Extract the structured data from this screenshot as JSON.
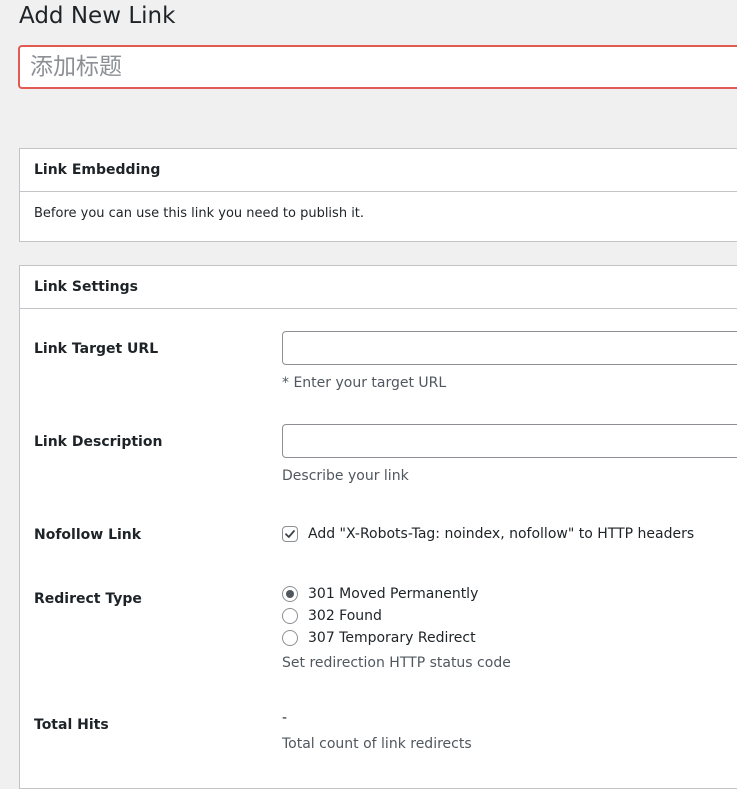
{
  "page": {
    "title": "Add New Link",
    "title_placeholder": "添加标题"
  },
  "embedding": {
    "header": "Link Embedding",
    "message": "Before you can use this link you need to publish it."
  },
  "settings": {
    "header": "Link Settings",
    "target_url": {
      "label": "Link Target URL",
      "value": "",
      "hint": "* Enter your target URL"
    },
    "description": {
      "label": "Link Description",
      "value": "",
      "hint": "Describe your link"
    },
    "nofollow": {
      "label": "Nofollow Link",
      "checked": true,
      "text": "Add \"X-Robots-Tag: noindex, nofollow\" to HTTP headers"
    },
    "redirect_type": {
      "label": "Redirect Type",
      "options": [
        {
          "label": "301 Moved Permanently",
          "selected": true
        },
        {
          "label": "302 Found",
          "selected": false
        },
        {
          "label": "307 Temporary Redirect",
          "selected": false
        }
      ],
      "hint": "Set redirection HTTP status code"
    },
    "total_hits": {
      "label": "Total Hits",
      "value": "-",
      "hint": "Total count of link redirects"
    }
  },
  "colors": {
    "title_input_border": "#e25b53",
    "background": "#f0f0f1"
  }
}
